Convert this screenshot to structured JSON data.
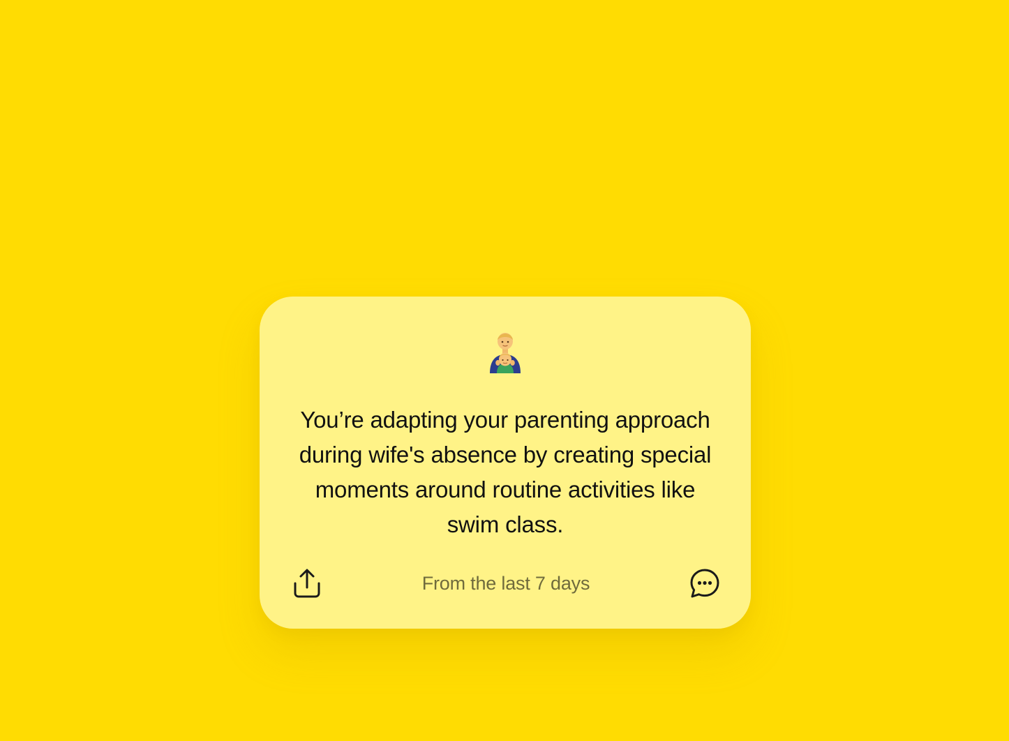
{
  "colors": {
    "background": "#FFDC02",
    "card": "#FFF387",
    "text": "#111111",
    "muted_text": "#6f6b3c",
    "icon_stroke": "#1a1a1a"
  },
  "card": {
    "emoji_icon": "parent-with-child-emoji-icon",
    "insight_text": "You’re adapting your parenting approach during wife's absence by creating special moments around routine activities like swim class.",
    "timeframe": "From the last 7 days",
    "share_icon": "share-upload-icon",
    "chat_icon": "chat-bubble-ellipsis-icon"
  }
}
